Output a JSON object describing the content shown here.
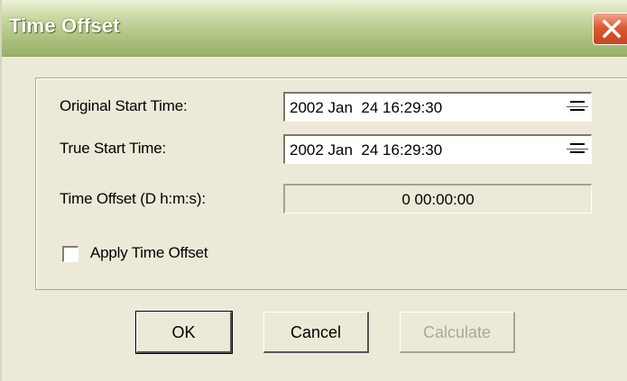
{
  "window": {
    "title": "Time Offset"
  },
  "form": {
    "original_start": {
      "label": "Original Start Time:",
      "value": "2002 Jan  24 16:29:30"
    },
    "true_start": {
      "label": "True Start Time:",
      "value": "2002 Jan  24 16:29:30"
    },
    "offset": {
      "label": "Time Offset (D h:m:s):",
      "value": "0 00:00:00"
    },
    "apply": {
      "label": "Apply Time Offset",
      "checked": false
    }
  },
  "buttons": {
    "ok": "OK",
    "cancel": "Cancel",
    "calculate": "Calculate"
  },
  "icons": {
    "close": "close-icon",
    "spinner": "spin-arrows-icon"
  }
}
